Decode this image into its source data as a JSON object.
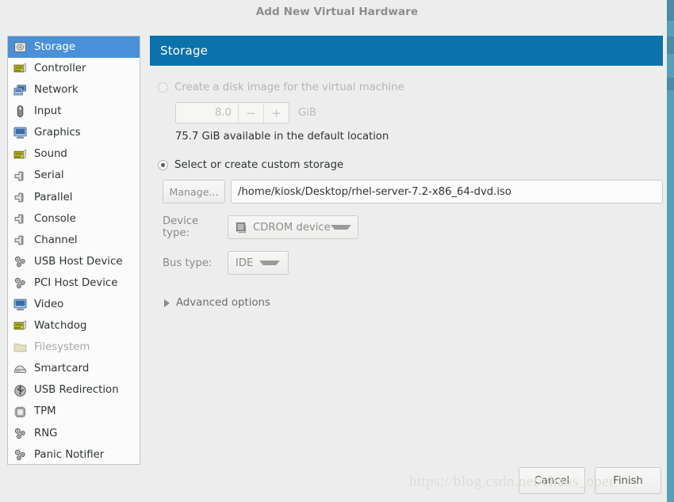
{
  "window": {
    "title": "Add New Virtual Hardware"
  },
  "sidebar": {
    "items": [
      {
        "label": "Storage",
        "icon": "storage-icon",
        "selected": true,
        "disabled": false
      },
      {
        "label": "Controller",
        "icon": "controller-icon",
        "selected": false,
        "disabled": false
      },
      {
        "label": "Network",
        "icon": "network-icon",
        "selected": false,
        "disabled": false
      },
      {
        "label": "Input",
        "icon": "mouse-icon",
        "selected": false,
        "disabled": false
      },
      {
        "label": "Graphics",
        "icon": "monitor-icon",
        "selected": false,
        "disabled": false
      },
      {
        "label": "Sound",
        "icon": "soundcard-icon",
        "selected": false,
        "disabled": false
      },
      {
        "label": "Serial",
        "icon": "plug-icon",
        "selected": false,
        "disabled": false
      },
      {
        "label": "Parallel",
        "icon": "plug-icon",
        "selected": false,
        "disabled": false
      },
      {
        "label": "Console",
        "icon": "plug-icon",
        "selected": false,
        "disabled": false
      },
      {
        "label": "Channel",
        "icon": "plug-icon",
        "selected": false,
        "disabled": false
      },
      {
        "label": "USB Host Device",
        "icon": "gears-icon",
        "selected": false,
        "disabled": false
      },
      {
        "label": "PCI Host Device",
        "icon": "gears-icon",
        "selected": false,
        "disabled": false
      },
      {
        "label": "Video",
        "icon": "monitor-icon",
        "selected": false,
        "disabled": false
      },
      {
        "label": "Watchdog",
        "icon": "soundcard-icon",
        "selected": false,
        "disabled": false
      },
      {
        "label": "Filesystem",
        "icon": "folder-icon",
        "selected": false,
        "disabled": true
      },
      {
        "label": "Smartcard",
        "icon": "smartcard-icon",
        "selected": false,
        "disabled": false
      },
      {
        "label": "USB Redirection",
        "icon": "usb-icon",
        "selected": false,
        "disabled": false
      },
      {
        "label": "TPM",
        "icon": "chip-icon",
        "selected": false,
        "disabled": false
      },
      {
        "label": "RNG",
        "icon": "gears-icon",
        "selected": false,
        "disabled": false
      },
      {
        "label": "Panic Notifier",
        "icon": "gears-icon",
        "selected": false,
        "disabled": false
      }
    ]
  },
  "page": {
    "header": "Storage",
    "create_disk": {
      "radio_label": "Create a disk image for the virtual machine",
      "selected": false,
      "disabled": true,
      "size_value": "8.0",
      "decrement_label": "−",
      "increment_label": "+",
      "unit": "GiB",
      "available_text": "75.7 GiB available in the default location"
    },
    "custom_storage": {
      "radio_label": "Select or create custom storage",
      "selected": true,
      "manage_label": "Manage...",
      "path_value": "/home/kiosk/Desktop/rhel-server-7.2-x86_64-dvd.iso"
    },
    "device_type": {
      "label": "Device type:",
      "value": "CDROM device",
      "icon": "cdrom-icon"
    },
    "bus_type": {
      "label": "Bus type:",
      "value": "IDE"
    },
    "advanced": {
      "label": "Advanced options",
      "expanded": false
    }
  },
  "footer": {
    "cancel_label": "Cancel",
    "finish_label": "Finish"
  },
  "watermark": {
    "text": "https://blog.csdn.net/chaos_oper"
  },
  "colors": {
    "accent_header": "#0b72ab",
    "selection": "#4a90d9",
    "window_bg": "#ededed",
    "list_bg": "#fbfbfb",
    "edge_strip": "#58a0b8"
  }
}
